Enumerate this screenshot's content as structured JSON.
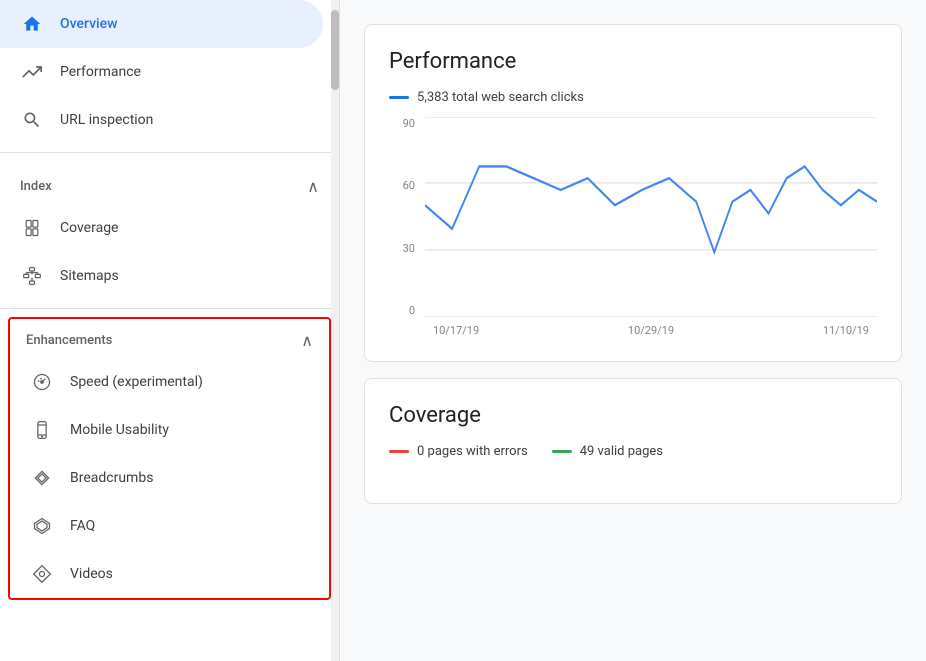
{
  "sidebar": {
    "items": [
      {
        "id": "overview",
        "label": "Overview",
        "active": true,
        "icon": "home"
      },
      {
        "id": "performance",
        "label": "Performance",
        "active": false,
        "icon": "trending-up"
      },
      {
        "id": "url-inspection",
        "label": "URL inspection",
        "active": false,
        "icon": "search"
      }
    ],
    "sections": [
      {
        "id": "index",
        "label": "Index",
        "expanded": true,
        "items": [
          {
            "id": "coverage",
            "label": "Coverage",
            "icon": "coverage"
          },
          {
            "id": "sitemaps",
            "label": "Sitemaps",
            "icon": "sitemaps"
          }
        ]
      },
      {
        "id": "enhancements",
        "label": "Enhancements",
        "expanded": true,
        "items": [
          {
            "id": "speed",
            "label": "Speed (experimental)",
            "icon": "speed"
          },
          {
            "id": "mobile-usability",
            "label": "Mobile Usability",
            "icon": "mobile"
          },
          {
            "id": "breadcrumbs",
            "label": "Breadcrumbs",
            "icon": "breadcrumbs"
          },
          {
            "id": "faq",
            "label": "FAQ",
            "icon": "faq"
          },
          {
            "id": "videos",
            "label": "Videos",
            "icon": "videos"
          }
        ]
      }
    ]
  },
  "main": {
    "performance_card": {
      "title": "Performance",
      "legend": "5,383 total web search clicks",
      "legend_color": "#1a73e8",
      "y_labels": [
        "90",
        "60",
        "30",
        "0"
      ],
      "x_labels": [
        "10/17/19",
        "10/29/19",
        "11/10/19"
      ]
    },
    "coverage_card": {
      "title": "Coverage",
      "legends": [
        {
          "label": "0 pages with errors",
          "color": "#ea4335"
        },
        {
          "label": "49 valid pages",
          "color": "#34a853"
        }
      ]
    }
  }
}
